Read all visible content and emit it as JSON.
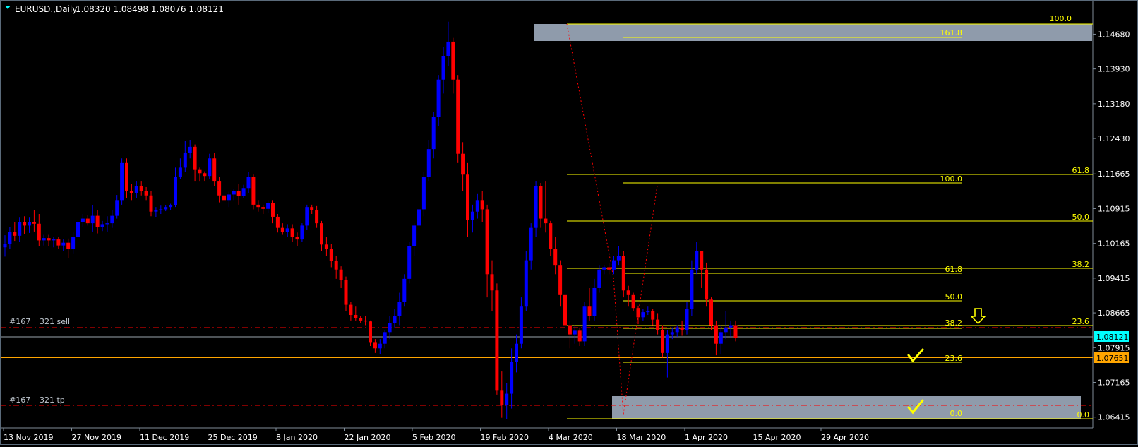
{
  "header": {
    "symbol_label": "EURUSD.,Daily",
    "ohlc": "1.08320 1.08498 1.08076 1.08121"
  },
  "colors": {
    "background": "#000000",
    "bull": "#0000ff",
    "bear": "#ff0000",
    "text": "#ffffff",
    "fib": "#ffff00",
    "zone": "#8090a8",
    "order": "#ffa500",
    "current_price_bg": "#00ffff",
    "order_price_bg": "#ffa500",
    "trade_line": "#ff0000"
  },
  "chart_data": {
    "type": "candlestick",
    "symbol": "EURUSD.",
    "timeframe": "Daily",
    "y_ticks": [
      "1.14680",
      "1.13930",
      "1.13180",
      "1.12430",
      "1.11665",
      "1.10915",
      "1.10165",
      "1.09415",
      "1.08665",
      "1.07915",
      "1.07165",
      "1.06415"
    ],
    "x_ticks": [
      "13 Nov 2019",
      "27 Nov 2019",
      "11 Dec 2019",
      "25 Dec 2019",
      "8 Jan 2020",
      "22 Jan 2020",
      "5 Feb 2020",
      "19 Feb 2020",
      "4 Mar 2020",
      "18 Mar 2020",
      "1 Apr 2020",
      "15 Apr 2020",
      "29 Apr 2020"
    ],
    "ylim": [
      1.0625,
      1.151
    ],
    "current_price": "1.08121",
    "order_price": "1.07651",
    "candles": [
      [
        1.1008,
        1.1034,
        1.0988,
        1.1016
      ],
      [
        1.1016,
        1.1052,
        1.1005,
        1.1041
      ],
      [
        1.1041,
        1.1063,
        1.1022,
        1.1033
      ],
      [
        1.1033,
        1.1072,
        1.102,
        1.1062
      ],
      [
        1.1062,
        1.1075,
        1.1036,
        1.1055
      ],
      [
        1.1055,
        1.1072,
        1.1039,
        1.1062
      ],
      [
        1.1062,
        1.1089,
        1.1042,
        1.1059
      ],
      [
        1.1059,
        1.108,
        1.101,
        1.1023
      ],
      [
        1.1023,
        1.1035,
        1.1012,
        1.1028
      ],
      [
        1.1028,
        1.1035,
        1.1011,
        1.1023
      ],
      [
        1.1023,
        1.103,
        1.1008,
        1.1025
      ],
      [
        1.1025,
        1.103,
        1.1005,
        1.1012
      ],
      [
        1.1012,
        1.1025,
        1.1,
        1.1018
      ],
      [
        1.1018,
        1.1027,
        1.0985,
        1.1005
      ],
      [
        1.1005,
        1.104,
        1.0995,
        1.103
      ],
      [
        1.103,
        1.1075,
        1.1025,
        1.1062
      ],
      [
        1.1062,
        1.108,
        1.1052,
        1.107
      ],
      [
        1.107,
        1.1077,
        1.1055,
        1.106
      ],
      [
        1.106,
        1.1099,
        1.1042,
        1.1076
      ],
      [
        1.1076,
        1.1089,
        1.1038,
        1.1052
      ],
      [
        1.1052,
        1.1065,
        1.1043,
        1.1058
      ],
      [
        1.1058,
        1.1075,
        1.1042,
        1.106
      ],
      [
        1.106,
        1.1089,
        1.105,
        1.1076
      ],
      [
        1.1076,
        1.1121,
        1.107,
        1.111
      ],
      [
        1.111,
        1.12,
        1.11,
        1.119
      ],
      [
        1.119,
        1.12,
        1.1115,
        1.113
      ],
      [
        1.113,
        1.1145,
        1.111,
        1.1125
      ],
      [
        1.1125,
        1.115,
        1.1115,
        1.114
      ],
      [
        1.114,
        1.115,
        1.112,
        1.113
      ],
      [
        1.113,
        1.1138,
        1.111,
        1.112
      ],
      [
        1.112,
        1.113,
        1.1075,
        1.1085
      ],
      [
        1.1085,
        1.1095,
        1.1073,
        1.1088
      ],
      [
        1.1088,
        1.1098,
        1.108,
        1.109
      ],
      [
        1.109,
        1.1099,
        1.1086,
        1.1095
      ],
      [
        1.1095,
        1.1102,
        1.1089,
        1.1099
      ],
      [
        1.1099,
        1.118,
        1.1095,
        1.116
      ],
      [
        1.116,
        1.12,
        1.1155,
        1.118
      ],
      [
        1.118,
        1.1238,
        1.117,
        1.1212
      ],
      [
        1.1212,
        1.124,
        1.12,
        1.1225
      ],
      [
        1.1225,
        1.123,
        1.115,
        1.1175
      ],
      [
        1.1175,
        1.118,
        1.115,
        1.1168
      ],
      [
        1.1168,
        1.1172,
        1.115,
        1.1162
      ],
      [
        1.1162,
        1.121,
        1.1155,
        1.12
      ],
      [
        1.12,
        1.1212,
        1.114,
        1.115
      ],
      [
        1.115,
        1.116,
        1.1105,
        1.112
      ],
      [
        1.112,
        1.1135,
        1.11,
        1.111
      ],
      [
        1.111,
        1.1128,
        1.1095,
        1.1122
      ],
      [
        1.1122,
        1.1133,
        1.111,
        1.1129
      ],
      [
        1.1129,
        1.1145,
        1.11,
        1.1119
      ],
      [
        1.1119,
        1.1143,
        1.1114,
        1.1136
      ],
      [
        1.1136,
        1.117,
        1.1125,
        1.116
      ],
      [
        1.116,
        1.1165,
        1.109,
        1.11
      ],
      [
        1.11,
        1.111,
        1.1085,
        1.1095
      ],
      [
        1.1095,
        1.11,
        1.108,
        1.1091
      ],
      [
        1.1091,
        1.111,
        1.1082,
        1.1104
      ],
      [
        1.1104,
        1.111,
        1.106,
        1.1074
      ],
      [
        1.1074,
        1.108,
        1.104,
        1.105
      ],
      [
        1.105,
        1.106,
        1.1035,
        1.1041
      ],
      [
        1.1041,
        1.1058,
        1.103,
        1.1049
      ],
      [
        1.1049,
        1.1058,
        1.102,
        1.103
      ],
      [
        1.103,
        1.104,
        1.101,
        1.1025
      ],
      [
        1.1025,
        1.106,
        1.102,
        1.1055
      ],
      [
        1.1055,
        1.11,
        1.1045,
        1.1095
      ],
      [
        1.1095,
        1.11,
        1.108,
        1.1088
      ],
      [
        1.1088,
        1.1097,
        1.105,
        1.106
      ],
      [
        1.106,
        1.1065,
        1.1,
        1.1014
      ],
      [
        1.1014,
        1.103,
        1.099,
        1.1005
      ],
      [
        1.1005,
        1.1015,
        1.0965,
        1.0978
      ],
      [
        1.0978,
        1.099,
        1.094,
        1.096
      ],
      [
        1.096,
        1.0967,
        1.092,
        1.0938
      ],
      [
        1.0938,
        1.0945,
        1.087,
        1.0884
      ],
      [
        1.0884,
        1.089,
        1.085,
        1.0862
      ],
      [
        1.0862,
        1.088,
        1.085,
        1.0855
      ],
      [
        1.0855,
        1.086,
        1.0845,
        1.085
      ],
      [
        1.085,
        1.086,
        1.084,
        1.0848
      ],
      [
        1.0848,
        1.085,
        1.0795,
        1.0802
      ],
      [
        1.0802,
        1.081,
        1.078,
        1.079
      ],
      [
        1.079,
        1.081,
        1.0777,
        1.08
      ],
      [
        1.08,
        1.083,
        1.079,
        1.0825
      ],
      [
        1.0825,
        1.086,
        1.081,
        1.0845
      ],
      [
        1.0845,
        1.0875,
        1.0835,
        1.086
      ],
      [
        1.086,
        1.091,
        1.084,
        1.089
      ],
      [
        1.089,
        1.095,
        1.088,
        1.094
      ],
      [
        1.094,
        1.102,
        1.093,
        1.101
      ],
      [
        1.101,
        1.106,
        1.099,
        1.1055
      ],
      [
        1.1055,
        1.11,
        1.1045,
        1.109
      ],
      [
        1.109,
        1.117,
        1.1075,
        1.116
      ],
      [
        1.116,
        1.124,
        1.115,
        1.122
      ],
      [
        1.122,
        1.13,
        1.12,
        1.129
      ],
      [
        1.129,
        1.138,
        1.127,
        1.137
      ],
      [
        1.137,
        1.144,
        1.134,
        1.142
      ],
      [
        1.142,
        1.1495,
        1.14,
        1.1452
      ],
      [
        1.1452,
        1.146,
        1.134,
        1.137
      ],
      [
        1.137,
        1.138,
        1.119,
        1.121
      ],
      [
        1.121,
        1.1235,
        1.113,
        1.1165
      ],
      [
        1.1165,
        1.119,
        1.103,
        1.1067
      ],
      [
        1.1067,
        1.11,
        1.104,
        1.1085
      ],
      [
        1.1085,
        1.1123,
        1.107,
        1.111
      ],
      [
        1.111,
        1.113,
        1.1063,
        1.109
      ],
      [
        1.109,
        1.11,
        1.09,
        1.095
      ],
      [
        1.095,
        1.098,
        1.087,
        1.0915
      ],
      [
        1.0915,
        1.093,
        1.069,
        1.07
      ],
      [
        1.07,
        1.074,
        1.064,
        1.0668
      ],
      [
        1.0668,
        1.0715,
        1.0638,
        1.0692
      ],
      [
        1.0692,
        1.079,
        1.066,
        1.076
      ],
      [
        1.076,
        1.082,
        1.0738,
        1.08
      ],
      [
        1.08,
        1.09,
        1.079,
        1.088
      ],
      [
        1.088,
        1.1,
        1.087,
        1.098
      ],
      [
        1.098,
        1.106,
        1.096,
        1.105
      ],
      [
        1.105,
        1.115,
        1.103,
        1.114
      ],
      [
        1.114,
        1.1147,
        1.105,
        1.107
      ],
      [
        1.107,
        1.115,
        1.104,
        1.106
      ],
      [
        1.106,
        1.1065,
        1.099,
        1.1005
      ],
      [
        1.1005,
        1.103,
        1.095,
        1.097
      ],
      [
        1.097,
        1.098,
        1.088,
        1.0905
      ],
      [
        1.0905,
        1.094,
        1.081,
        1.084
      ],
      [
        1.084,
        1.085,
        1.079,
        1.082
      ],
      [
        1.082,
        1.084,
        1.08,
        1.0828
      ],
      [
        1.0828,
        1.0835,
        1.0795,
        1.0805
      ],
      [
        1.0805,
        1.089,
        1.0795,
        1.088
      ],
      [
        1.088,
        1.092,
        1.085,
        1.086
      ],
      [
        1.086,
        1.094,
        1.085,
        1.092
      ],
      [
        1.092,
        1.097,
        1.091,
        1.096
      ],
      [
        1.096,
        1.097,
        1.095,
        1.0965
      ],
      [
        1.0965,
        1.0975,
        1.095,
        1.096
      ],
      [
        1.096,
        1.099,
        1.095,
        1.098
      ],
      [
        1.098,
        1.101,
        1.097,
        1.099
      ],
      [
        1.099,
        1.1,
        1.09,
        1.0915
      ],
      [
        1.0915,
        1.0925,
        1.088,
        1.0905
      ],
      [
        1.0905,
        1.091,
        1.087,
        1.0877
      ],
      [
        1.0877,
        1.0882,
        1.0842,
        1.0857
      ],
      [
        1.0857,
        1.0875,
        1.085,
        1.0868
      ],
      [
        1.0868,
        1.088,
        1.0862,
        1.087
      ],
      [
        1.087,
        1.0875,
        1.084,
        1.0852
      ],
      [
        1.0852,
        1.0866,
        1.082,
        1.083
      ],
      [
        1.083,
        1.084,
        1.077,
        1.078
      ],
      [
        1.078,
        1.083,
        1.0727,
        1.082
      ],
      [
        1.082,
        1.0835,
        1.081,
        1.0825
      ],
      [
        1.0825,
        1.084,
        1.0815,
        1.0835
      ],
      [
        1.0835,
        1.085,
        1.0817,
        1.083
      ],
      [
        1.083,
        1.089,
        1.082,
        1.0875
      ],
      [
        1.0875,
        1.098,
        1.086,
        1.096
      ],
      [
        1.096,
        1.102,
        1.095,
        1.1
      ],
      [
        1.1,
        1.1,
        1.092,
        1.096
      ],
      [
        1.096,
        1.0975,
        1.088,
        1.0895
      ],
      [
        1.0895,
        1.09,
        1.083,
        1.084
      ],
      [
        1.084,
        1.085,
        1.0775,
        1.08
      ],
      [
        1.08,
        1.084,
        1.0778,
        1.0825
      ],
      [
        1.0825,
        1.087,
        1.081,
        1.0835
      ],
      [
        1.0835,
        1.085,
        1.0815,
        1.084
      ],
      [
        1.084,
        1.085,
        1.0805,
        1.0812
      ]
    ],
    "fib_sets": [
      {
        "levels": [
          "100.0",
          "161.8"
        ]
      },
      {
        "levels": [
          "61.8",
          "50.0",
          "38.2",
          "23.6",
          "0.0"
        ]
      },
      {
        "levels": [
          "100.0",
          "61.8",
          "50.0",
          "38.2",
          "23.6",
          "0.0"
        ]
      }
    ],
    "trade_labels": [
      {
        "ticket": "#167",
        "text": "321 sell"
      },
      {
        "ticket": "#167",
        "text": "321 tp"
      }
    ],
    "annotations": [
      "down-arrow-marker",
      "checkmark-marker",
      "checkmark-marker"
    ]
  }
}
